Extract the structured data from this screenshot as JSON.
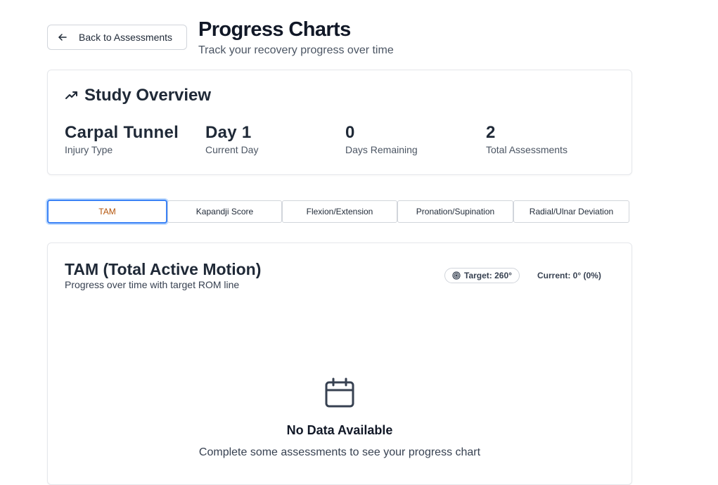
{
  "header": {
    "back_label": "Back to Assessments",
    "title": "Progress Charts",
    "subtitle": "Track your recovery progress over time"
  },
  "overview": {
    "title": "Study Overview",
    "icon": "trending-up-icon",
    "stats": [
      {
        "value": "Carpal Tunnel",
        "label": "Injury Type"
      },
      {
        "value": "Day 1",
        "label": "Current Day"
      },
      {
        "value": "0",
        "label": "Days Remaining"
      },
      {
        "value": "2",
        "label": "Total Assessments"
      }
    ]
  },
  "tabs": [
    {
      "label": "TAM",
      "active": true
    },
    {
      "label": "Kapandji Score",
      "active": false
    },
    {
      "label": "Flexion/Extension",
      "active": false
    },
    {
      "label": "Pronation/Supination",
      "active": false
    },
    {
      "label": "Radial/Ulnar Deviation",
      "active": false
    }
  ],
  "chart": {
    "title": "TAM (Total Active Motion)",
    "subtitle": "Progress over time with target ROM line",
    "target_label": "Target: 260°",
    "current_label": "Current: 0° (0%)",
    "empty_title": "No Data Available",
    "empty_message": "Complete some assessments to see your progress chart"
  },
  "colors": {
    "accent_active_tab_text": "#b45309",
    "focus_ring": "#3b82f6",
    "border": "#e5e7eb"
  }
}
